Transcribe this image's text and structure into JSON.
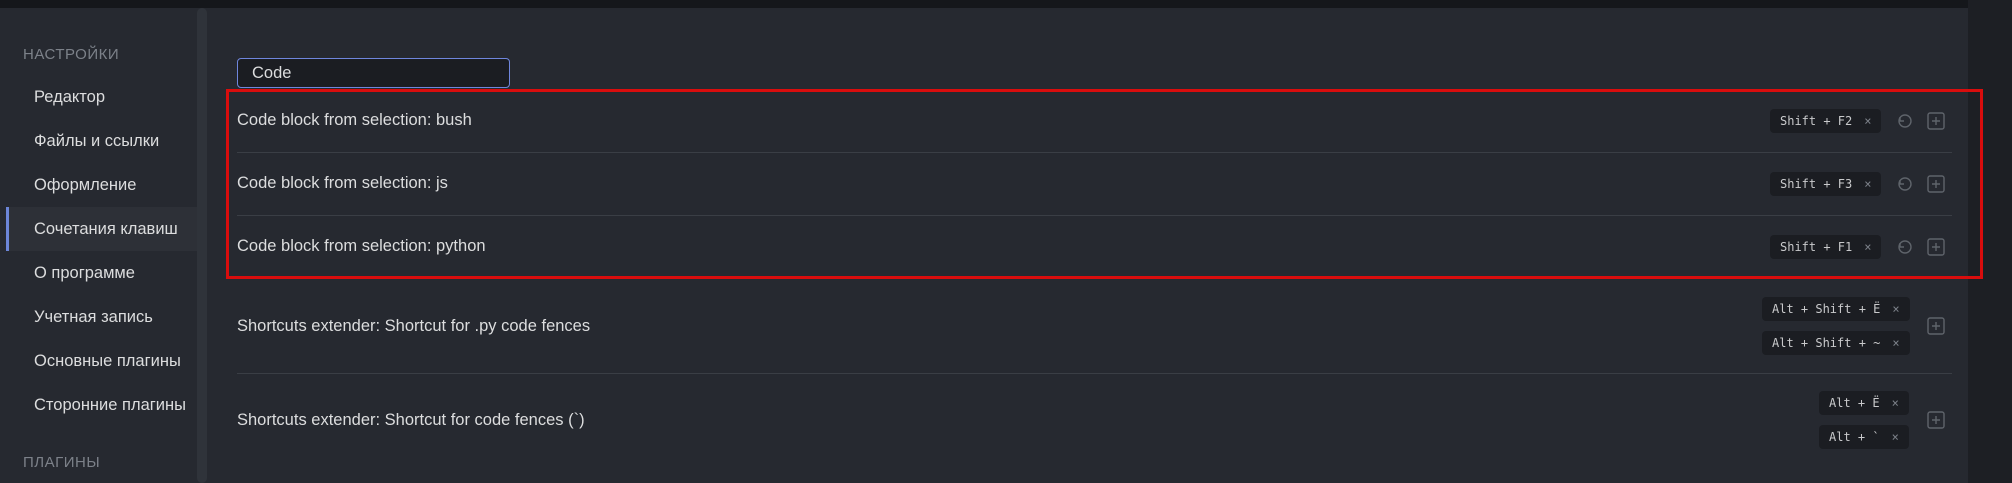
{
  "sidebar": {
    "section_settings": "НАСТРОЙКИ",
    "items": [
      {
        "label": "Редактор"
      },
      {
        "label": "Файлы и ссылки"
      },
      {
        "label": "Оформление"
      },
      {
        "label": "Сочетания клавиш",
        "active": true
      },
      {
        "label": "О программе"
      },
      {
        "label": "Учетная запись"
      },
      {
        "label": "Основные плагины"
      },
      {
        "label": "Сторонние плагины"
      }
    ],
    "section_plugins": "ПЛАГИНЫ"
  },
  "search": {
    "value": "Code"
  },
  "hotkeys": [
    {
      "label": "Code block from selection: bush",
      "keys": [
        "Shift + F2"
      ]
    },
    {
      "label": "Code block from selection: js",
      "keys": [
        "Shift + F3"
      ]
    },
    {
      "label": "Code block from selection: python",
      "keys": [
        "Shift + F1"
      ]
    },
    {
      "label": "Shortcuts extender: Shortcut for .py code fences",
      "keys": [
        "Alt + Shift + Ё",
        "Alt + Shift + ~"
      ]
    },
    {
      "label": "Shortcuts extender: Shortcut for code fences (`)",
      "keys": [
        "Alt + Ё",
        "Alt + `"
      ]
    }
  ],
  "remove_glyph": "×",
  "icons": {
    "restore": "restore-icon",
    "add": "add-hotkey-icon"
  },
  "colors": {
    "accent": "#6c86d8",
    "highlight": "#d90d0d",
    "background": "#262930"
  }
}
